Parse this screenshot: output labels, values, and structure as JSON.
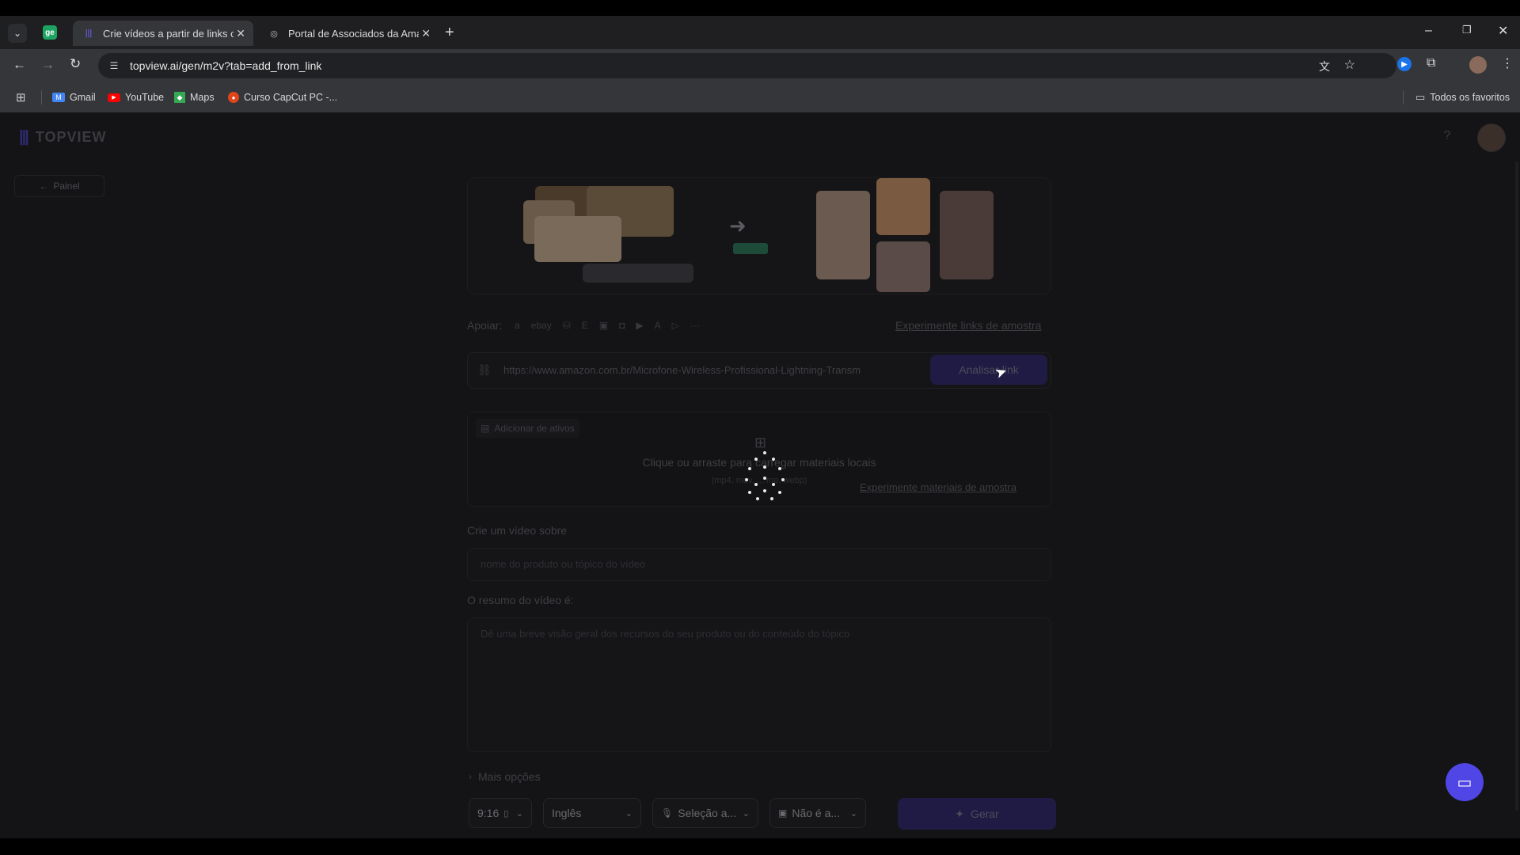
{
  "browser": {
    "tabs": [
      {
        "title": "Crie vídeos a partir de links ou",
        "active": true
      },
      {
        "title": "Portal de Associados da Amazo",
        "active": false
      }
    ],
    "url": "topview.ai/gen/m2v?tab=add_from_link",
    "bookmarks": [
      "Gmail",
      "YouTube",
      "Maps",
      "Curso CapCut PC -..."
    ],
    "all_bookmarks_label": "Todos os favoritos"
  },
  "app": {
    "brand": "TOPVIEW",
    "back_label": "Painel",
    "support_label": "Apoiar:",
    "sample_links_label": "Experimente links de amostra",
    "link_value": "https://www.amazon.com.br/Microfone-Wireless-Profissional-Lightning-Transm",
    "analyze_label": "Analisar link",
    "add_assets_label": "Adicionar de ativos",
    "upload_text": "Clique ou arraste para carregar materiais locais",
    "upload_formats": "(mp4, mov,  ...  mp, webp)",
    "sample_materials_label": "Experimente materiais de amostra",
    "video_about_label": "Crie um vídeo sobre",
    "video_about_placeholder": "nome do produto ou tópico do vídeo",
    "summary_label": "O resumo do vídeo é:",
    "summary_placeholder": "Dê uma breve visão geral dos recursos do seu produto ou do conteúdo do tópico",
    "more_options_label": "Mais opções",
    "ratio_label": "9:16",
    "language_label": "Inglês",
    "voice_label": "Seleção a...",
    "avatar_label": "Não é a...",
    "generate_label": "Gerar"
  },
  "colors": {
    "accent": "#4a3fd6",
    "chat_button": "#4f46e5",
    "background": "#141416"
  }
}
